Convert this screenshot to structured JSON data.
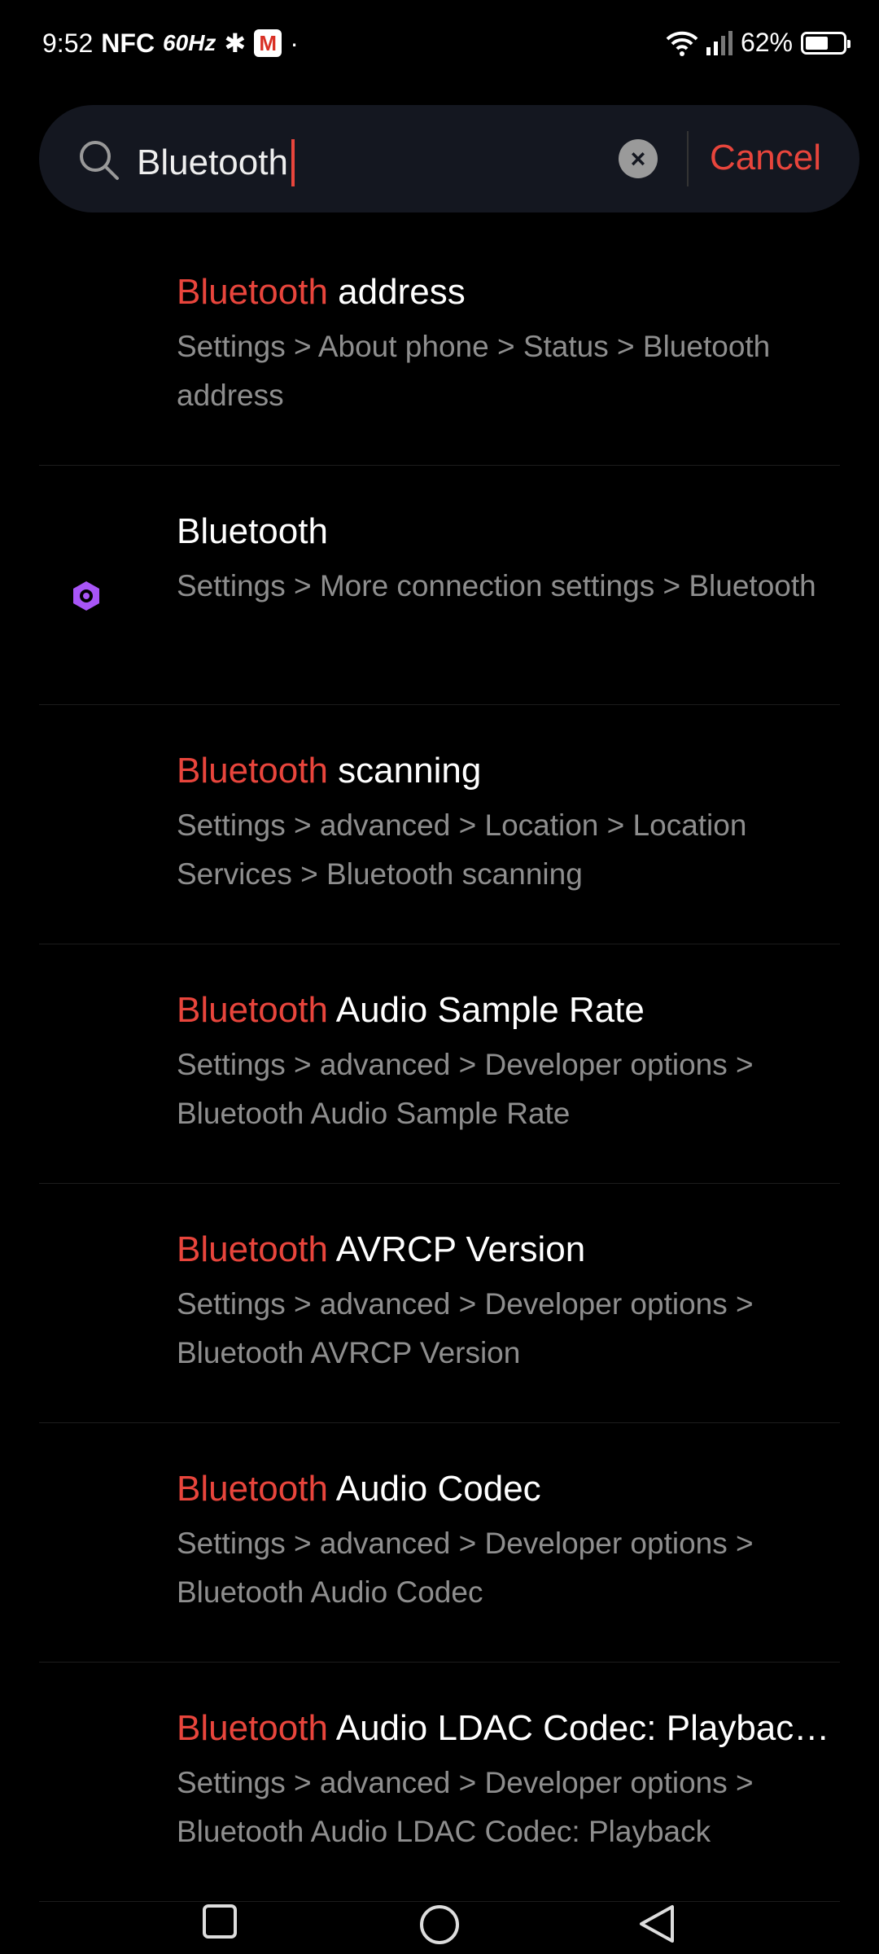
{
  "status_bar": {
    "time": "9:52",
    "nfc": "NFC",
    "refresh": "60Hz",
    "battery": "62%",
    "battery_level": 62
  },
  "search": {
    "value": "Bluetooth",
    "cancel_label": "Cancel"
  },
  "results": [
    {
      "highlight": "Bluetooth",
      "rest": " address",
      "path": "Settings > About phone > Status > Bluetooth address",
      "icon": ""
    },
    {
      "highlight": "",
      "rest": "Bluetooth",
      "path": "Settings > More connection settings > Bluetooth",
      "icon": "hexagon-nut-icon",
      "icon_color": "#a855f7"
    },
    {
      "highlight": "Bluetooth",
      "rest": " scanning",
      "path": "Settings > advanced > Location > Location Services > Bluetooth scanning",
      "icon": ""
    },
    {
      "highlight": "Bluetooth",
      "rest": " Audio Sample Rate",
      "path": "Settings > advanced > Developer options > Bluetooth Audio Sample Rate",
      "icon": ""
    },
    {
      "highlight": "Bluetooth",
      "rest": " AVRCP Version",
      "path": "Settings > advanced > Developer options > Bluetooth AVRCP Version",
      "icon": ""
    },
    {
      "highlight": "Bluetooth",
      "rest": " Audio Codec",
      "path": "Settings > advanced > Developer options > Bluetooth Audio Codec",
      "icon": ""
    },
    {
      "highlight": "Bluetooth",
      "rest": " Audio LDAC Codec: Playback Quality",
      "path": "Settings > advanced > Developer options > Bluetooth Audio LDAC Codec: Playback",
      "icon": ""
    }
  ],
  "colors": {
    "accent": "#e8453c",
    "search_bg": "#141720",
    "secondary_text": "#8e8e8e"
  }
}
